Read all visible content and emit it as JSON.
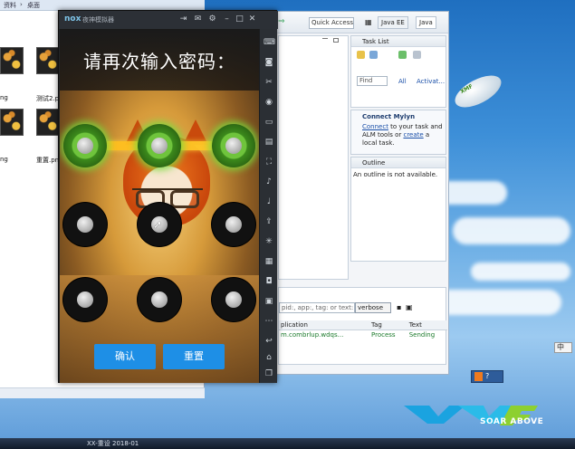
{
  "explorer": {
    "address_parts": [
      "资料",
      "›",
      "桌面"
    ],
    "items": [
      {
        "label": "ng"
      },
      {
        "label": "测试2.p"
      },
      {
        "label": "ng"
      },
      {
        "label": "重置.pn"
      }
    ]
  },
  "eclipse": {
    "quick_access": "Quick Access",
    "perspectives": [
      "Java EE",
      "Java"
    ],
    "task_list": {
      "title": "Task List",
      "find_placeholder": "Find",
      "all_label": "All",
      "activate_label": "Activat..."
    },
    "mylyn": {
      "title": "Connect Mylyn",
      "connect_link": "Connect",
      "text_a": " to your task and ALM tools or ",
      "create_link": "create",
      "text_b": " a local task."
    },
    "outline": {
      "title": "Outline",
      "message": "An outline is not available."
    },
    "console": {
      "filter_placeholder": "pid:, app:, tag: or text:",
      "level": "verbose",
      "columns": [
        "plication",
        "Tag",
        "Text"
      ],
      "rows": [
        [
          "m.combrlup.wdqs...",
          "Process",
          "Sending"
        ]
      ]
    }
  },
  "nox": {
    "brand": "nox",
    "title": "夜神模拟器",
    "prompt": "请再次输入密码：",
    "confirm_label": "确认",
    "reset_label": "重置",
    "pattern": {
      "rows": [
        [
          true,
          true,
          true
        ],
        [
          false,
          false,
          false
        ],
        [
          false,
          false,
          false
        ]
      ]
    }
  },
  "desktop": {
    "logo_text": "SOAR ABOVE",
    "ime_label": "中"
  },
  "taskbar": {
    "items": [
      "XX-重设 2018-01"
    ]
  }
}
